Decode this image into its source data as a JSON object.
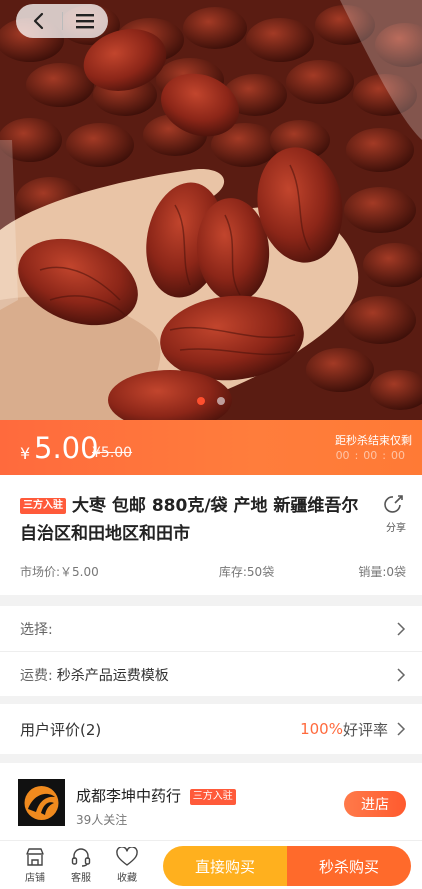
{
  "colors": {
    "accent": "#ff6a3d",
    "buy_direct": "#ffb01e",
    "buy_flash": "#ff6a2b"
  },
  "hero": {
    "image_alt": "dried red jujube dates in hand",
    "slide_count": 2,
    "active_slide": 0
  },
  "price": {
    "currency": "¥",
    "current": "5.00",
    "original": "¥5.00"
  },
  "countdown": {
    "label": "距秒杀结束仅剩",
    "hours": "00",
    "minutes": "00",
    "seconds": "00"
  },
  "product": {
    "tag": "三方入驻",
    "title": "大枣 包邮 880克/袋 产地 新疆维吾尔自治区和田地区和田市",
    "share_label": "分享",
    "market_price": "市场价:￥5.00",
    "stock": "库存:50袋",
    "sales": "销量:0袋"
  },
  "options": {
    "select_label": "选择:",
    "shipping_label": "运费:",
    "shipping_value": "秒杀产品运费模板"
  },
  "reviews": {
    "label": "用户评价(2)",
    "percent": "100%",
    "rate_label": "好评率"
  },
  "store": {
    "name": "成都李坤中药行",
    "tag": "三方入驻",
    "followers": "39人关注",
    "enter_label": "进店"
  },
  "bottom": {
    "shop_label": "店铺",
    "service_label": "客服",
    "favorite_label": "收藏",
    "buy_direct_label": "直接购买",
    "flash_buy_label": "秒杀购买"
  }
}
